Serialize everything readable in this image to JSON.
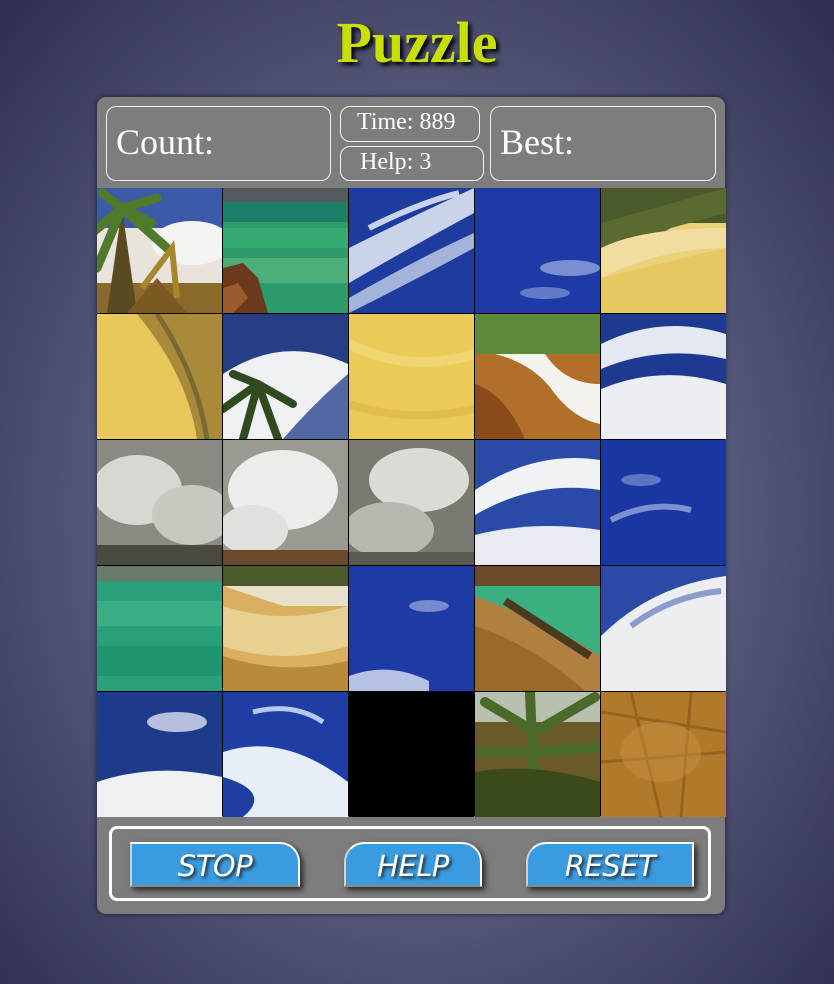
{
  "title": "Puzzle",
  "stats": {
    "count_label": "Count:",
    "count_value": "",
    "best_label": "Best:",
    "best_value": "",
    "time_label": "Time:",
    "time_value": "889",
    "help_label": "Help:",
    "help_value": "3"
  },
  "buttons": {
    "stop": "STOP",
    "help": "HELP",
    "reset": "RESET"
  },
  "colors": {
    "title": "#c8e000",
    "panel": "#7d7d7d",
    "button": "#3a9be0"
  },
  "board": {
    "rows": 5,
    "cols": 5,
    "empty_tile": "row-5-col-3",
    "tiles": [
      "palm-tree-sky",
      "turquoise-sea-rock",
      "blue-sky-streaks",
      "blue-sky",
      "beach-sand-shore",
      "sand-shoreline",
      "palm-frond-sky",
      "yellow-sand",
      "rocky-shore-wave",
      "sky-clouds",
      "grey-clouds",
      "white-clouds",
      "grey-clouds",
      "sky-clouds",
      "blue-sky",
      "turquoise-sea",
      "beach-hut-shore",
      "blue-sky",
      "pier-sea",
      "sky-clouds",
      "sky-clouds",
      "blue-sky-streaks",
      "empty",
      "palm-bush",
      "dry-earth"
    ]
  }
}
